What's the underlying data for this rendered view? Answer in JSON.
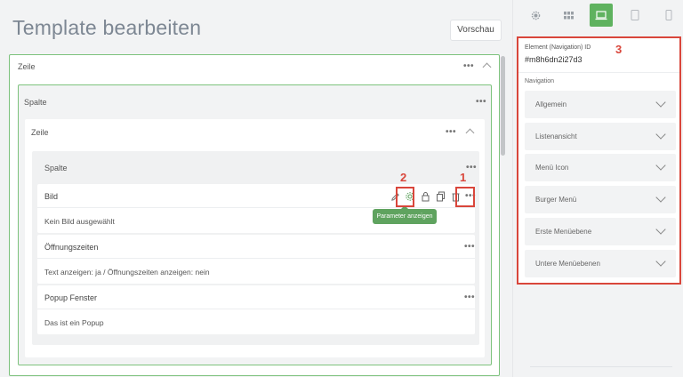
{
  "header": {
    "title": "Template bearbeiten",
    "preview_label": "Vorschau"
  },
  "editor": {
    "outer_row": {
      "label": "Zeile",
      "menu": "•••"
    },
    "column": {
      "label": "Spalte",
      "menu": "•••"
    },
    "inner_row": {
      "label": "Zeile",
      "menu": "•••"
    },
    "inner_column": {
      "label": "Spalte",
      "menu": "•••"
    },
    "cards": [
      {
        "title": "Bild",
        "text": "Kein Bild ausgewählt",
        "menu": "•••"
      },
      {
        "title": "Öffnungszeiten",
        "text": "Text anzeigen: ja / Öffnungszeiten anzeigen: nein",
        "menu": "•••"
      },
      {
        "title": "Popup Fenster",
        "text": "Das ist ein Popup",
        "menu": "•••"
      }
    ],
    "tooltip": "Parameter anzeigen"
  },
  "annotations": {
    "one": "1",
    "two": "2",
    "three": "3",
    "color": "#d9463b"
  },
  "sidebar": {
    "tabs": [
      "gear-icon",
      "grid-icon",
      "desktop-icon",
      "tablet-icon",
      "mobile-icon"
    ],
    "active_tab": "desktop-icon",
    "accent_color": "#5fb25f",
    "element_id_label": "Element (Navigation) ID",
    "element_id": "#m8h6dn2i27d3",
    "section_label": "Navigation",
    "accordions": [
      {
        "label": "Allgemein"
      },
      {
        "label": "Listenansicht"
      },
      {
        "label": "Menü Icon"
      },
      {
        "label": "Burger Menü"
      },
      {
        "label": "Erste Menüebene"
      },
      {
        "label": "Untere Menüebenen"
      }
    ]
  }
}
